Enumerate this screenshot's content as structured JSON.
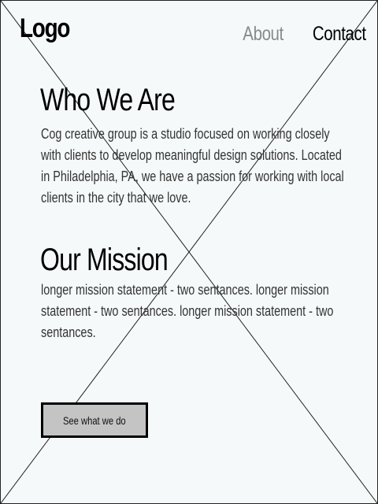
{
  "header": {
    "logo": "Logo",
    "nav": [
      {
        "label": "About"
      },
      {
        "label": "Contact"
      }
    ]
  },
  "who_we_are": {
    "title": "Who We Are",
    "body": "Cog creative group is a studio focused on working closely with clients to develop meaningful design solutions. Located in Philadelphia, PA, we have a passion for working with local clients in the city that we love."
  },
  "mission": {
    "title": "Our Mission",
    "body": "longer mission statement - two sentances. longer mission statement - two sentances. longer mission statement - two sentances."
  },
  "cta": {
    "label": "See what we do"
  },
  "colors": {
    "background": "#f5f9fa",
    "nav_inactive": "#8a8a8a",
    "button_fill": "#c4c4c4"
  }
}
